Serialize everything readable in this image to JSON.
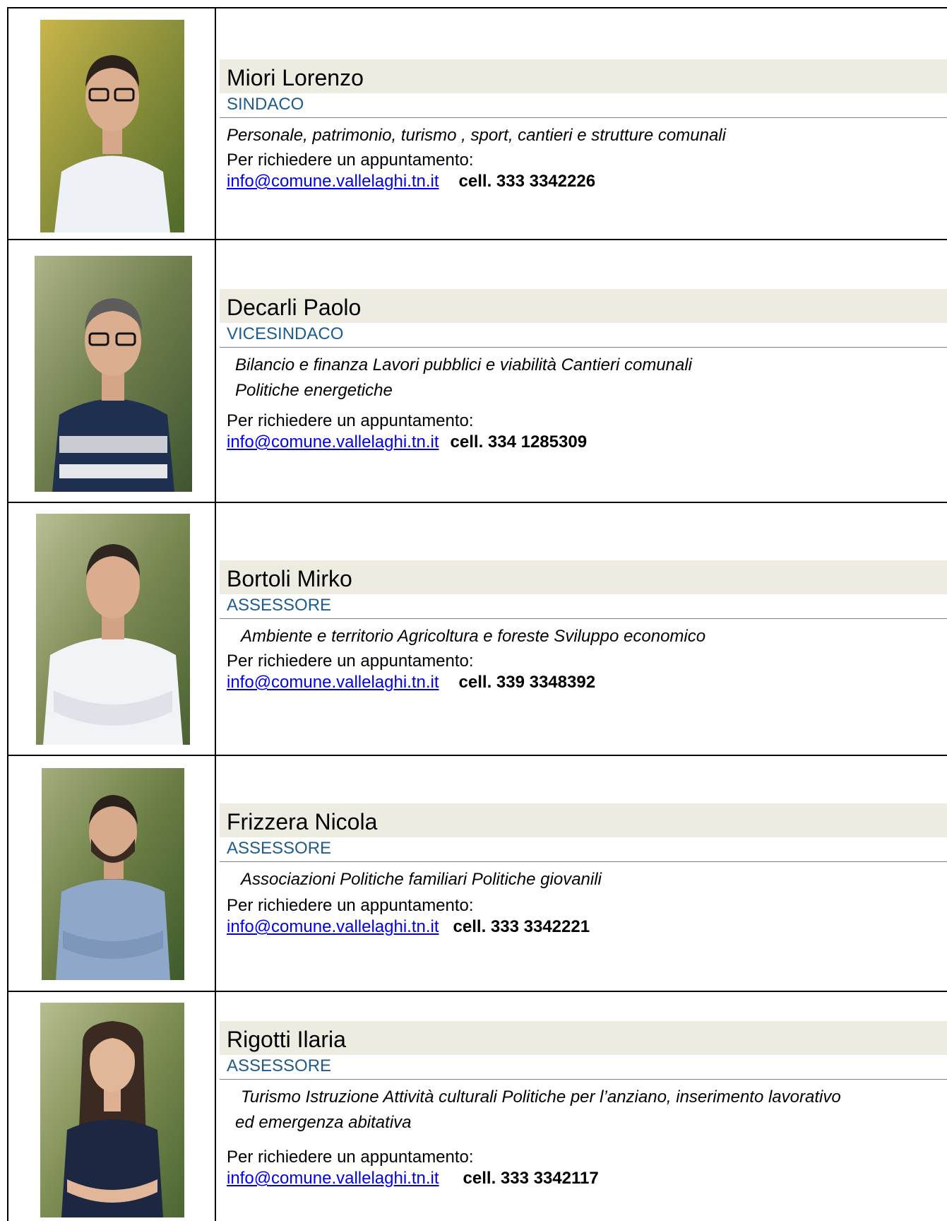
{
  "people": [
    {
      "name": "Miori Lorenzo",
      "role": "SINDACO",
      "duties": [
        "Personale, patrimonio, turismo , sport, cantieri e strutture comunali"
      ],
      "request_label": "Per richiedere un appuntamento:",
      "email": "info@comune.vallelaghi.tn.it",
      "phone": "cell. 333 3342226"
    },
    {
      "name": "Decarli Paolo",
      "role": "VICESINDACO",
      "duties": [
        "Bilancio e finanza  Lavori pubblici e viabilità  Cantieri comunali",
        "Politiche energetiche"
      ],
      "request_label": "Per richiedere un appuntamento:",
      "email": "info@comune.vallelaghi.tn.it",
      "phone": "cell. 334 1285309"
    },
    {
      "name": "Bortoli Mirko",
      "role": "ASSESSORE",
      "duties": [
        "Ambiente e territorio  Agricoltura e foreste  Sviluppo economico"
      ],
      "request_label": "Per richiedere un appuntamento:",
      "email": "info@comune.vallelaghi.tn.it",
      "phone": "cell. 339 3348392"
    },
    {
      "name": "Frizzera Nicola",
      "role": "ASSESSORE",
      "duties": [
        "Associazioni Politiche familiari Politiche giovanili"
      ],
      "request_label": "Per richiedere un appuntamento:",
      "email": "info@comune.vallelaghi.tn.it",
      "phone": "cell. 333 3342221"
    },
    {
      "name": "Rigotti Ilaria",
      "role": "ASSESSORE",
      "duties": [
        "Turismo Istruzione Attività culturali Politiche per l’anziano, inserimento lavorativo",
        "ed emergenza abitativa"
      ],
      "request_label": "Per richiedere un appuntamento:",
      "email": "info@comune.vallelaghi.tn.it",
      "phone": "cell. 333 3342117"
    }
  ],
  "colors": {
    "name_band": "#eeece1",
    "role_text": "#1f5c8b",
    "link": "#0000ee"
  }
}
